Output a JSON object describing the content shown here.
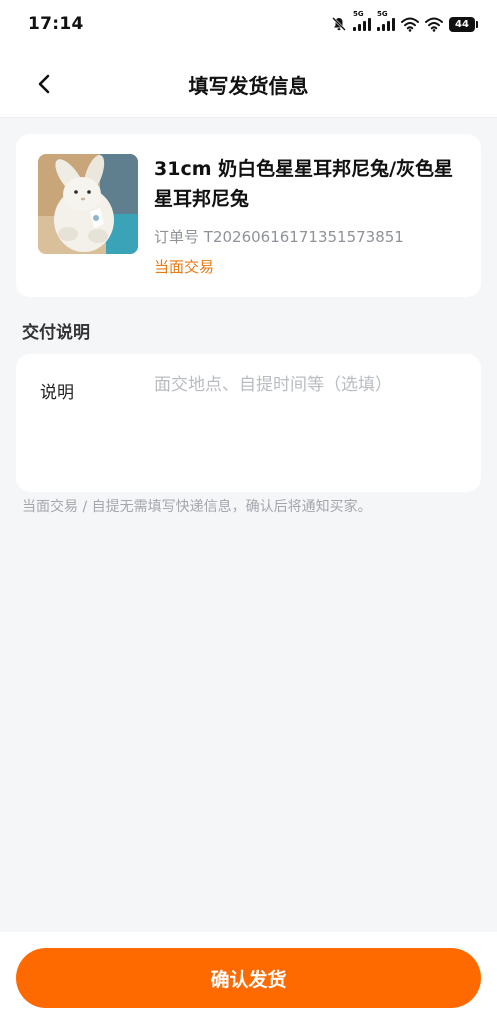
{
  "status_bar": {
    "time": "17:14",
    "network_1": "5G",
    "network_2": "5G",
    "battery": "44"
  },
  "nav": {
    "title": "填写发货信息"
  },
  "product": {
    "title": "31cm 奶白色星星耳邦尼兔/灰色星星耳邦尼兔",
    "order_label": "订单号",
    "order_number": "T20260616171351573851",
    "trade_type": "当面交易"
  },
  "delivery": {
    "section_title": "交付说明",
    "note_label": "说明",
    "note_value": "",
    "note_placeholder": "面交地点、自提时间等（选填）",
    "hint": "当面交易 / 自提无需填写快递信息，确认后将通知买家。"
  },
  "actions": {
    "confirm_label": "确认发货"
  },
  "colors": {
    "accent": "#ff6a00",
    "trade_type": "#ea7a12",
    "background": "#f5f6f8"
  }
}
